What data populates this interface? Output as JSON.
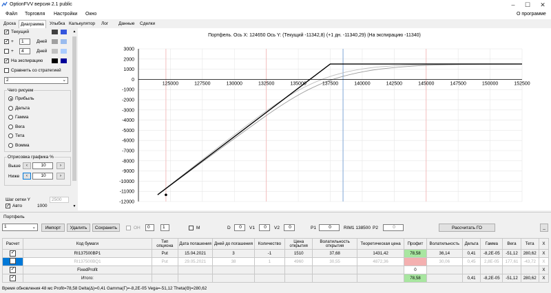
{
  "window": {
    "title": "OptionFVV версия 2.1 public"
  },
  "menu": {
    "items": [
      "Файл",
      "Торговля",
      "Настройки",
      "Окно"
    ],
    "about": "О программе"
  },
  "tabs": [
    "Доска",
    "Диаграмма",
    "Улыбка",
    "Калькулятор",
    "Лог",
    "Данные",
    "Сделки"
  ],
  "left": {
    "current": "Текущий",
    "plus1_days": "1",
    "plus2_days": "4",
    "plus_label": "+",
    "days": "Дней",
    "expiration": "На экспирацию",
    "compare": "Сравнить со стратегией",
    "strategy_select": "2",
    "what_group": "Чего рисуем",
    "radios": [
      "Прибыль",
      "Дельта",
      "Гамма",
      "Вега",
      "Тета",
      "Вомма"
    ],
    "draw_group": "Отрисовка графика %",
    "above": "Выше",
    "below": "Ниже",
    "above_val": "10",
    "below_val": "10",
    "grid_step": "Шаг сетки Y",
    "grid_step_val": "2500",
    "auto": "Авто",
    "auto_val": "1000",
    "colors": {
      "current": [
        "#404040",
        "#3355dd"
      ],
      "p1": [
        "#a0a0a0",
        "#99bbee"
      ],
      "p2": [
        "#c0c0c0",
        "#aaccff"
      ],
      "exp": [
        "#000000",
        "#000099"
      ]
    }
  },
  "chart_data": {
    "type": "line",
    "title": "Портфель. Ось X: 124650 Ось Y:  (Текущий -11342,8)  (+1 дн. -11340,29)  (На экспирацию -11340)",
    "xlim": [
      122500,
      152500
    ],
    "ylim": [
      -12000,
      3000
    ],
    "xticks": [
      "125000",
      "127500",
      "130000",
      "132500",
      "135000",
      "137500",
      "140000",
      "142500",
      "145000",
      "147500",
      "150000",
      "152500"
    ],
    "yticks": [
      "3000",
      "2000",
      "1000",
      "0",
      "-1000",
      "-2000",
      "-3000",
      "-4000",
      "-5000",
      "-6000",
      "-7000",
      "-8000",
      "-9000",
      "-10000",
      "-11000",
      "-12000"
    ],
    "markers": {
      "red": [
        124650,
        132500,
        145000
      ],
      "blue": 138500
    },
    "series": [
      {
        "color": "#000000",
        "x": [
          124000,
          137500,
          152500
        ],
        "y": [
          -11340,
          1510,
          1510
        ]
      },
      {
        "color": "#999999",
        "x": [
          124000,
          130000,
          134000,
          137000,
          140000,
          143000,
          146000,
          152500
        ],
        "y": [
          -11340,
          -5800,
          -2200,
          -200,
          800,
          1250,
          1450,
          1510
        ]
      },
      {
        "color": "#bbbbbb",
        "x": [
          124000,
          130000,
          134000,
          137000,
          140000,
          143000,
          146000,
          152500
        ],
        "y": [
          -11340,
          -5400,
          -1700,
          200,
          1100,
          1400,
          1490,
          1510
        ]
      }
    ],
    "start_point": [
      124650,
      -11342.8
    ]
  },
  "portfolio": {
    "label": "Портфель",
    "select": "1",
    "import": "Импорт",
    "delete": "Удалить",
    "save": "Сохранить",
    "oh": "ОН",
    "oh_a": "0",
    "oh_b": "1",
    "m": "М",
    "d": "D",
    "d_val": "0",
    "v1": "V1",
    "v1_val": "0",
    "v2": "V2",
    "v2_val": "0",
    "p1": "P1",
    "p1_val": "0",
    "ri": "RIM1 138500",
    "p2": "P2",
    "p2_val": "0",
    "calc_go": "Рассчитать ГО",
    "underscore": "_"
  },
  "table": {
    "headers": [
      "Расчет",
      "Код бумаги",
      "Тип опциона",
      "Дата погашения",
      "Дней до погашения",
      "Количество",
      "Цена открытия",
      "Волатильность открытия",
      "Теоретическая цена",
      "Профит",
      "Волатильность",
      "Дельта",
      "Гамма",
      "Вега",
      "Тета",
      "X"
    ],
    "rows": [
      {
        "checked": true,
        "cells": [
          "RI137500BP1",
          "Put",
          "15.04.2021",
          "3",
          "-1",
          "1510",
          "37,68",
          "1431,42",
          "78,58",
          "36,14",
          "0,41",
          "-8,2E-05",
          "-51,12",
          "280,62",
          "X"
        ],
        "dim": false,
        "profit_color": "#a8e6a0"
      },
      {
        "checked": false,
        "cells": [
          "RI137500BQ1",
          "Put",
          "29.05.2021",
          "38",
          "1",
          "4960",
          "30,55",
          "4872,36",
          "",
          "30,06",
          "0,45",
          "2,8E-05",
          "177,61",
          "-43,72",
          "X"
        ],
        "dim": true,
        "profit_color": "#f4b0b0"
      },
      {
        "checked": true,
        "cells": [
          "FixedProfit",
          "",
          "",
          "",
          "",
          "",
          "",
          "",
          "0",
          "",
          "",
          "",
          "",
          "",
          "X"
        ],
        "dim": false,
        "profit_color": "#ffffff"
      },
      {
        "checked": true,
        "cells": [
          "Итого:",
          "",
          "",
          "",
          "",
          "",
          "",
          "",
          "78,58",
          "",
          "0,41",
          "-8,2E-05",
          "-51,12",
          "280,62",
          "X"
        ],
        "dim": false,
        "profit_color": "#a8e6a0"
      }
    ]
  },
  "status": "Время обновления 48 мс   Profit=78,58 Delta(Δ)=0,41 Gamma(Γ)=-8,2E-05 Vega=-51,12 Theta(Θ)=280,62"
}
